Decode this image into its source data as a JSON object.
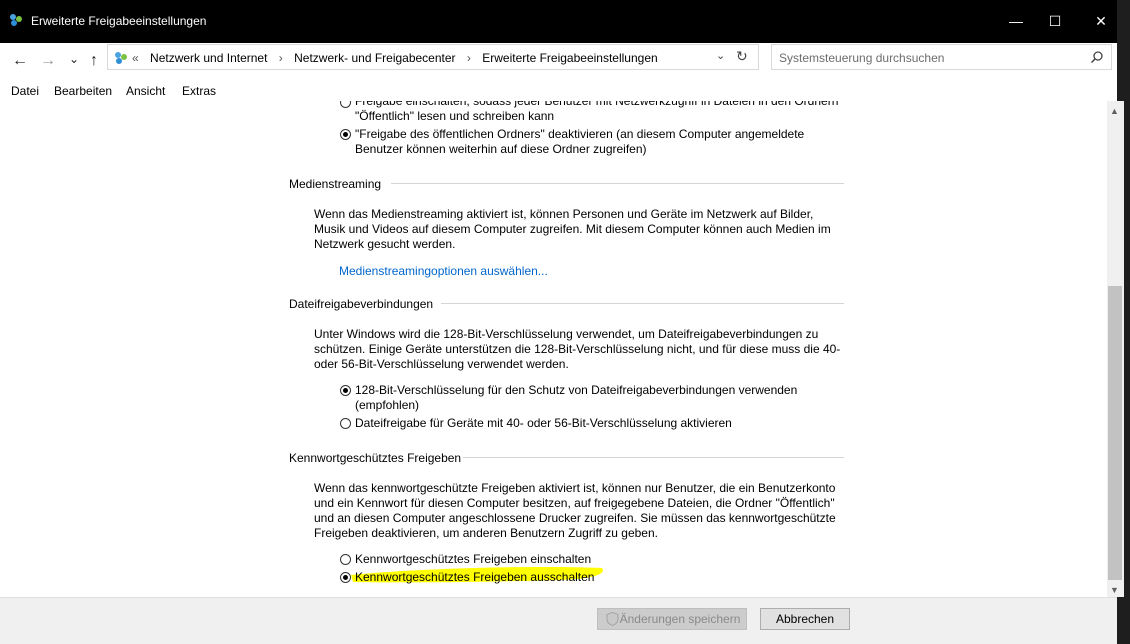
{
  "window": {
    "title": "Erweiterte Freigabeeinstellungen",
    "controls": {
      "minimize": "—",
      "maximize": "☐",
      "close": "✕"
    }
  },
  "nav": {
    "back": "←",
    "forward": "→",
    "recent": "⌄",
    "up": "↑"
  },
  "address": {
    "overflow": "«",
    "crumbs": [
      "Netzwerk und Internet",
      "Netzwerk- und Freigabecenter",
      "Erweiterte Freigabeeinstellungen"
    ],
    "separator": "›",
    "dropdown": "⌄",
    "refresh": "↻"
  },
  "search": {
    "placeholder": "Systemsteuerung durchsuchen"
  },
  "menu": [
    "Datei",
    "Bearbeiten",
    "Ansicht",
    "Extras"
  ],
  "public_folder": {
    "option_on_line1": "Freigabe einschalten, sodass jeder Benutzer mit Netzwerkzugriff in Dateien in den Ordnern",
    "option_on_line2": "\"Öffentlich\" lesen und schreiben kann",
    "option_off_line1": "\"Freigabe des öffentlichen Ordners\" deaktivieren (an diesem Computer angemeldete",
    "option_off_line2": "Benutzer können weiterhin auf diese Ordner zugreifen)",
    "selected": "off"
  },
  "media": {
    "title": "Medienstreaming",
    "line1": "Wenn das Medienstreaming aktiviert ist, können Personen und Geräte im Netzwerk auf Bilder,",
    "line2": "Musik und Videos auf diesem Computer zugreifen. Mit diesem Computer können auch Medien im",
    "line3": "Netzwerk gesucht werden.",
    "link": "Medienstreamingoptionen auswählen..."
  },
  "file_sharing": {
    "title": "Dateifreigabeverbindungen",
    "line1": "Unter Windows wird die 128-Bit-Verschlüsselung verwendet, um Dateifreigabeverbindungen zu",
    "line2": "schützen. Einige Geräte unterstützen die 128-Bit-Verschlüsselung nicht, und für diese muss die 40-",
    "line3": "oder 56-Bit-Verschlüsselung verwendet werden.",
    "opt128_line1": "128-Bit-Verschlüsselung für den Schutz von Dateifreigabeverbindungen verwenden",
    "opt128_line2": "(empfohlen)",
    "opt40": "Dateifreigabe für Geräte mit 40- oder 56-Bit-Verschlüsselung aktivieren",
    "selected": "128"
  },
  "password": {
    "title": "Kennwortgeschütztes Freigeben",
    "line1": "Wenn das kennwortgeschützte Freigeben aktiviert ist, können nur Benutzer, die ein Benutzerkonto",
    "line2": "und ein Kennwort für diesen Computer besitzen, auf freigegebene Dateien, die Ordner \"Öffentlich\"",
    "line3": "und an diesen Computer angeschlossene Drucker zugreifen. Sie müssen das kennwortgeschützte",
    "line4": "Freigeben deaktivieren, um anderen Benutzern Zugriff zu geben.",
    "opt_on": "Kennwortgeschütztes Freigeben einschalten",
    "opt_off": "Kennwortgeschütztes Freigeben ausschalten",
    "selected": "off",
    "highlight_color": "#ffff00"
  },
  "footer": {
    "save": "Änderungen speichern",
    "cancel": "Abbrechen"
  },
  "colors": {
    "titlebar": "#000000",
    "link": "#0066cc",
    "footer_bg": "#f0f0f0"
  }
}
